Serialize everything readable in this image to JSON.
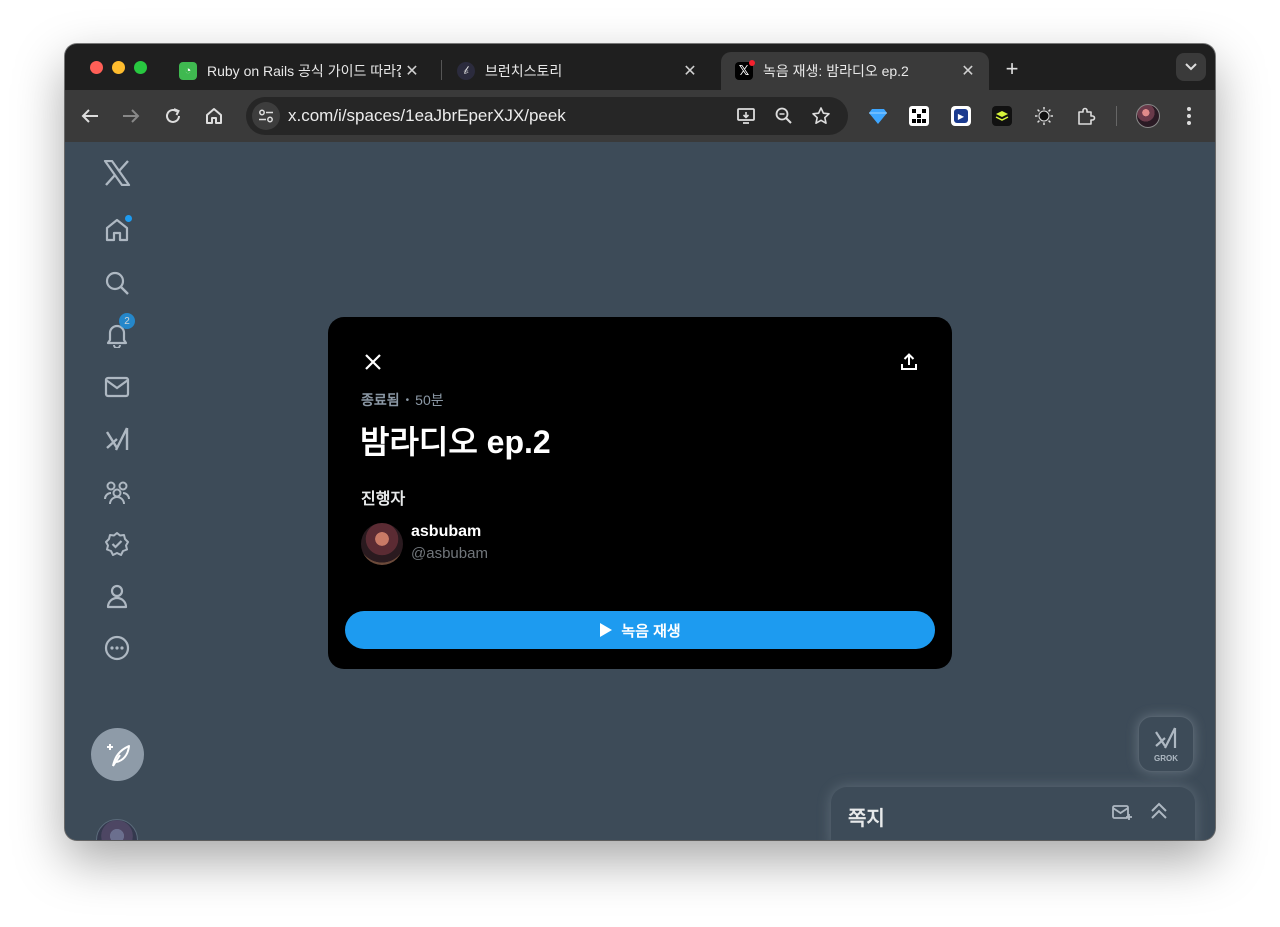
{
  "browser": {
    "tabs": [
      {
        "title": "Ruby on Rails 공식 가이드 따라잡기",
        "favicon": "rails-guide-icon",
        "favicon_color": "#3fb950"
      },
      {
        "title": "브런치스토리",
        "favicon": "brunch-icon",
        "favicon_color": "#2a2a3a"
      },
      {
        "title": "녹음 재생: 밤라디오 ep.2",
        "favicon": "x-logo-icon",
        "favicon_color": "#000000",
        "active": true
      }
    ],
    "url": "x.com/i/spaces/1eaJbrEperXJX/peek"
  },
  "sidebar": {
    "notification_count": "2"
  },
  "space": {
    "status": "종료됨",
    "duration": "50분",
    "title": "밤라디오 ep.2",
    "host_section_label": "진행자",
    "host": {
      "name": "asbubam",
      "handle": "@asbubam"
    },
    "play_label": "녹음 재생"
  },
  "grok": {
    "label": "GROK"
  },
  "messages": {
    "title": "쪽지"
  },
  "colors": {
    "accent": "#1d9bf0",
    "background": "#3d4b58",
    "modal": "#000000"
  }
}
